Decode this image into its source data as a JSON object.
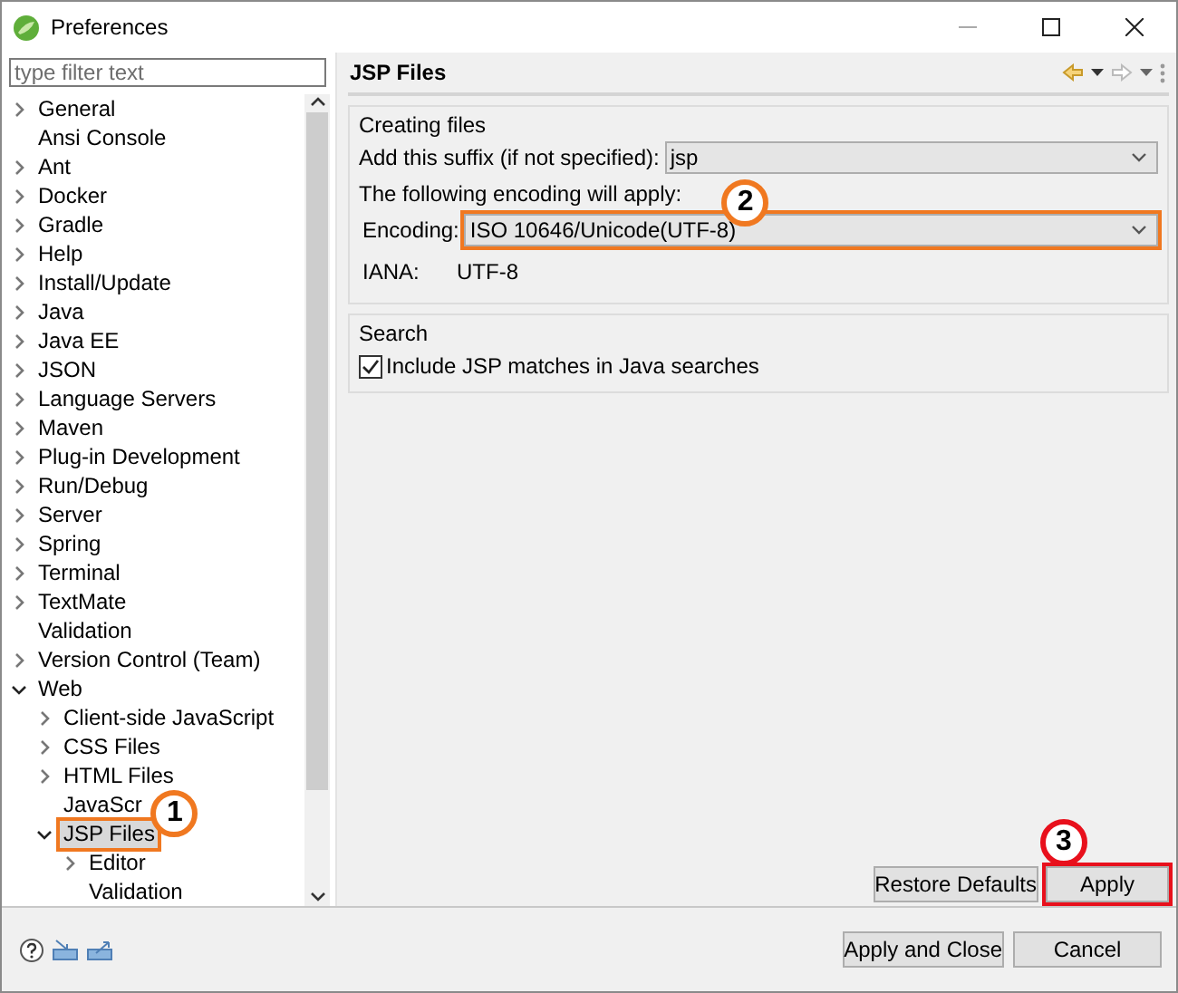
{
  "window": {
    "title": "Preferences"
  },
  "filter": {
    "placeholder": "type filter text"
  },
  "tree": [
    {
      "label": "General",
      "expanded": false,
      "selected": false
    },
    {
      "label": "Ansi Console",
      "selected": false
    },
    {
      "label": "Ant",
      "expanded": false,
      "selected": false
    },
    {
      "label": "Docker",
      "expanded": false,
      "selected": false
    },
    {
      "label": "Gradle",
      "expanded": false,
      "selected": false
    },
    {
      "label": "Help",
      "expanded": false,
      "selected": false
    },
    {
      "label": "Install/Update",
      "expanded": false,
      "selected": false
    },
    {
      "label": "Java",
      "expanded": false,
      "selected": false
    },
    {
      "label": "Java EE",
      "expanded": false,
      "selected": false
    },
    {
      "label": "JSON",
      "expanded": false,
      "selected": false
    },
    {
      "label": "Language Servers",
      "expanded": false,
      "selected": false
    },
    {
      "label": "Maven",
      "expanded": false,
      "selected": false
    },
    {
      "label": "Plug-in Development",
      "expanded": false,
      "selected": false
    },
    {
      "label": "Run/Debug",
      "expanded": false,
      "selected": false
    },
    {
      "label": "Server",
      "expanded": false,
      "selected": false
    },
    {
      "label": "Spring",
      "expanded": false,
      "selected": false
    },
    {
      "label": "Terminal",
      "expanded": false,
      "selected": false
    },
    {
      "label": "TextMate",
      "expanded": false,
      "selected": false
    },
    {
      "label": "Validation",
      "selected": false
    },
    {
      "label": "Version Control (Team)",
      "expanded": false,
      "selected": false
    },
    {
      "label": "Web",
      "expanded": true,
      "selected": false,
      "children": [
        {
          "label": "Client-side JavaScript",
          "expanded": false,
          "selected": false
        },
        {
          "label": "CSS Files",
          "expanded": false,
          "selected": false
        },
        {
          "label": "HTML Files",
          "expanded": false,
          "selected": false
        },
        {
          "label": "JavaScr",
          "selected": false
        },
        {
          "label": "JSP Files",
          "expanded": true,
          "selected": true,
          "callout": {
            "number": "1",
            "color": "#f07820"
          },
          "children": [
            {
              "label": "Editor",
              "expanded": false,
              "selected": false
            },
            {
              "label": "Validation",
              "selected": false
            }
          ]
        }
      ]
    }
  ],
  "page": {
    "title": "JSP Files",
    "groups": [
      {
        "title": "Creating files",
        "rows": [
          {
            "kind": "combo",
            "label": "Add this suffix (if not specified):",
            "value": "jsp"
          },
          {
            "kind": "text",
            "text": "The following encoding will apply:"
          },
          {
            "kind": "combo",
            "label": "Encoding:",
            "value": "ISO 10646/Unicode(UTF-8)",
            "callout": {
              "number": "2",
              "color": "#f07820"
            }
          },
          {
            "kind": "pair",
            "label": "IANA:",
            "value": "UTF-8"
          }
        ]
      },
      {
        "title": "Search",
        "rows": [
          {
            "kind": "checkbox",
            "label": "Include JSP matches in Java searches",
            "checked": true
          }
        ]
      }
    ],
    "buttons": [
      {
        "label": "Restore Defaults"
      },
      {
        "label": "Apply",
        "callout": {
          "number": "3",
          "color": "#e8101c"
        }
      }
    ]
  },
  "footer_buttons": [
    {
      "label": "Apply and Close"
    },
    {
      "label": "Cancel"
    }
  ]
}
